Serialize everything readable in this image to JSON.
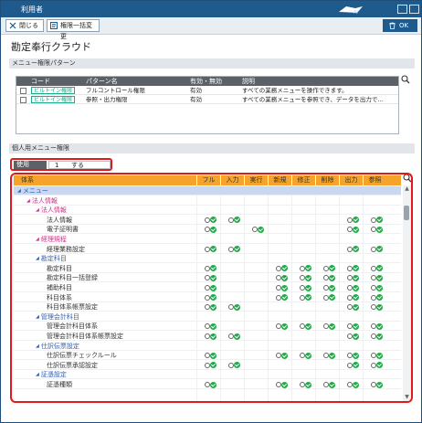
{
  "window": {
    "title": "利用者"
  },
  "toolbar": {
    "close_label": "閉じる",
    "bulk_label": "権限一括変更",
    "ok_label": "OK"
  },
  "page_title": "勘定奉行クラウド",
  "pattern_section": {
    "heading": "メニュー権限パターン",
    "columns": {
      "code": "コード",
      "name": "パターン名",
      "enabled": "有効・無効",
      "desc": "説明"
    },
    "rows": [
      {
        "badge": "ビルトイン権限",
        "name": "フルコントロール権限",
        "enabled": "有効",
        "desc": "すべての業務メニューを操作できます。"
      },
      {
        "badge": "ビルトイン権限",
        "name": "参照・出力権限",
        "enabled": "有効",
        "desc": "すべての業務メニューを参照でき、データを出力で…"
      }
    ]
  },
  "personal_section": {
    "heading": "個人用メニュー権限",
    "use_label": "使用",
    "use_value_num": "1",
    "use_value_text": "する"
  },
  "tree": {
    "columns": {
      "system": "体系",
      "full": "フル",
      "input": "入力",
      "exec": "実行",
      "new": "新規",
      "edit": "修正",
      "delete": "削除",
      "output": "出力",
      "ref": "参照"
    },
    "rows": [
      {
        "label": "メニュー",
        "level": 0,
        "tri": true,
        "color": "#2f5fb5",
        "p": []
      },
      {
        "label": "法人情報",
        "level": 1,
        "tri": true,
        "color": "#d0358a",
        "p": []
      },
      {
        "label": "法人情報",
        "level": 2,
        "tri": true,
        "color": "#d0358a",
        "p": []
      },
      {
        "label": "法人情報",
        "level": 3,
        "tri": false,
        "color": "#333333",
        "p": [
          "full",
          "input",
          "output",
          "ref"
        ]
      },
      {
        "label": "電子証明書",
        "level": 3,
        "tri": false,
        "color": "#333333",
        "p": [
          "full",
          "exec",
          "output",
          "ref"
        ]
      },
      {
        "label": "経理規程",
        "level": 2,
        "tri": true,
        "color": "#d0358a",
        "p": []
      },
      {
        "label": "経理業務設定",
        "level": 3,
        "tri": false,
        "color": "#333333",
        "p": [
          "full",
          "input",
          "output",
          "ref"
        ]
      },
      {
        "label": "勘定科目",
        "level": 2,
        "tri": true,
        "color": "#2f5fb5",
        "p": []
      },
      {
        "label": "勘定科目",
        "level": 3,
        "tri": false,
        "color": "#333333",
        "p": [
          "full",
          "new",
          "edit",
          "delete",
          "output",
          "ref"
        ]
      },
      {
        "label": "勘定科目一括登録",
        "level": 3,
        "tri": false,
        "color": "#333333",
        "p": [
          "full",
          "new",
          "edit",
          "delete",
          "output",
          "ref"
        ]
      },
      {
        "label": "補助科目",
        "level": 3,
        "tri": false,
        "color": "#333333",
        "p": [
          "full",
          "new",
          "edit",
          "delete",
          "output",
          "ref"
        ]
      },
      {
        "label": "科目体系",
        "level": 3,
        "tri": false,
        "color": "#333333",
        "p": [
          "full",
          "new",
          "edit",
          "delete",
          "output",
          "ref"
        ]
      },
      {
        "label": "科目体系帳票設定",
        "level": 3,
        "tri": false,
        "color": "#333333",
        "p": [
          "full",
          "input",
          "output",
          "ref"
        ]
      },
      {
        "label": "管理会計科目",
        "level": 2,
        "tri": true,
        "color": "#2f5fb5",
        "p": []
      },
      {
        "label": "管理会計科目体系",
        "level": 3,
        "tri": false,
        "color": "#333333",
        "p": [
          "full",
          "new",
          "edit",
          "delete",
          "output",
          "ref"
        ]
      },
      {
        "label": "管理会計科目体系帳票設定",
        "level": 3,
        "tri": false,
        "color": "#333333",
        "p": [
          "full",
          "input",
          "output",
          "ref"
        ]
      },
      {
        "label": "仕訳伝票設定",
        "level": 2,
        "tri": true,
        "color": "#2f5fb5",
        "p": []
      },
      {
        "label": "仕訳伝票チェックルール",
        "level": 3,
        "tri": false,
        "color": "#333333",
        "p": [
          "full",
          "new",
          "edit",
          "delete",
          "output",
          "ref"
        ]
      },
      {
        "label": "仕訳伝票承認設定",
        "level": 3,
        "tri": false,
        "color": "#333333",
        "p": [
          "full",
          "input",
          "output",
          "ref"
        ]
      },
      {
        "label": "証憑設定",
        "level": 2,
        "tri": true,
        "color": "#2f5fb5",
        "p": []
      },
      {
        "label": "証憑種類",
        "level": 3,
        "tri": false,
        "color": "#333333",
        "p": [
          "full",
          "new",
          "edit",
          "delete",
          "output",
          "ref"
        ]
      }
    ]
  },
  "colors": {
    "titlebar": "#1f5a8c",
    "header_orange": "#f5a32a",
    "highlight": "#e01a1a",
    "check": "#23a84a",
    "badge": "#1eaa8c"
  },
  "icons": [
    "close-icon",
    "bulk-edit-icon",
    "trash-icon",
    "search-icon",
    "circle-icon",
    "check-icon"
  ]
}
